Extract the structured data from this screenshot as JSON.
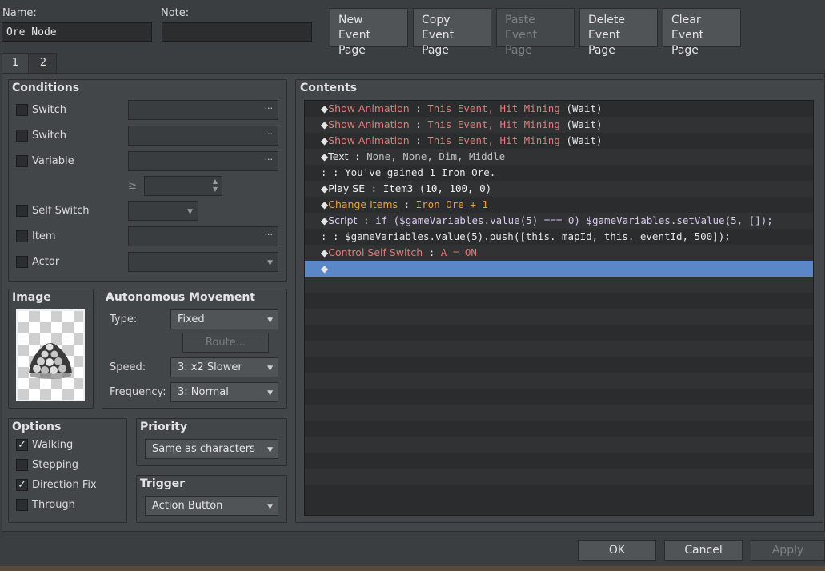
{
  "header": {
    "name_label": "Name:",
    "name_value": "Ore Node",
    "note_label": "Note:",
    "note_value": ""
  },
  "page_buttons": {
    "new": [
      "New",
      "Event Page"
    ],
    "copy": [
      "Copy",
      "Event Page"
    ],
    "paste": [
      "Paste",
      "Event Page"
    ],
    "delete": [
      "Delete",
      "Event Page"
    ],
    "clear": [
      "Clear",
      "Event Page"
    ]
  },
  "tabs": [
    "1",
    "2"
  ],
  "conditions": {
    "title": "Conditions",
    "switch1": "Switch",
    "switch2": "Switch",
    "variable": "Variable",
    "gte_symbol": "≥",
    "self_switch": "Self Switch",
    "item": "Item",
    "actor": "Actor",
    "dots": "···"
  },
  "image": {
    "title": "Image"
  },
  "movement": {
    "title": "Autonomous Movement",
    "type_label": "Type:",
    "type_value": "Fixed",
    "route_button": "Route...",
    "speed_label": "Speed:",
    "speed_value": "3: x2 Slower",
    "frequency_label": "Frequency:",
    "frequency_value": "3: Normal"
  },
  "options": {
    "title": "Options",
    "walking": "Walking",
    "walking_checked": true,
    "stepping": "Stepping",
    "stepping_checked": false,
    "direction_fix": "Direction Fix",
    "direction_fix_checked": true,
    "through": "Through",
    "through_checked": false,
    "checkmark": "✓"
  },
  "priority": {
    "title": "Priority",
    "value": "Same as characters"
  },
  "trigger": {
    "title": "Trigger",
    "value": "Action Button"
  },
  "contents": {
    "title": "Contents",
    "bullet": "◆",
    "rows": [
      {
        "cmd": "Show Animation",
        "sep": " : ",
        "params": "This Event, Hit Mining",
        "suffix": " (Wait)"
      },
      {
        "cmd": "Show Animation",
        "sep": " : ",
        "params": "This Event, Hit Mining",
        "suffix": " (Wait)"
      },
      {
        "cmd": "Show Animation",
        "sep": " : ",
        "params": "This Event, Hit Mining",
        "suffix": " (Wait)"
      },
      {
        "cmd": "Text",
        "sep": " : ",
        "params": "None, None, Dim, Middle",
        "suffix": ""
      },
      {
        "cont_prefix": ":",
        "cont_sep": "     : ",
        "cont_text": "You've gained 1 Iron Ore."
      },
      {
        "cmd": "Play SE",
        "sep": " : ",
        "params": "Item3 (10, 100, 0)",
        "suffix": ""
      },
      {
        "cmd": "Change Items",
        "sep": " : ",
        "params": "Iron Ore + 1",
        "suffix": ""
      },
      {
        "cmd": "Script",
        "sep": " : ",
        "params": "if ($gameVariables.value(5) === 0) $gameVariables.setValue(5, []);",
        "suffix": ""
      },
      {
        "cont_prefix": ":",
        "cont_sep": "       : ",
        "cont_text": "$gameVariables.value(5).push([this._mapId, this._eventId, 500]);"
      },
      {
        "cmd": "Control Self Switch",
        "sep": " : ",
        "params": "A = ON",
        "suffix": ""
      }
    ]
  },
  "footer": {
    "ok": "OK",
    "cancel": "Cancel",
    "apply": "Apply"
  }
}
